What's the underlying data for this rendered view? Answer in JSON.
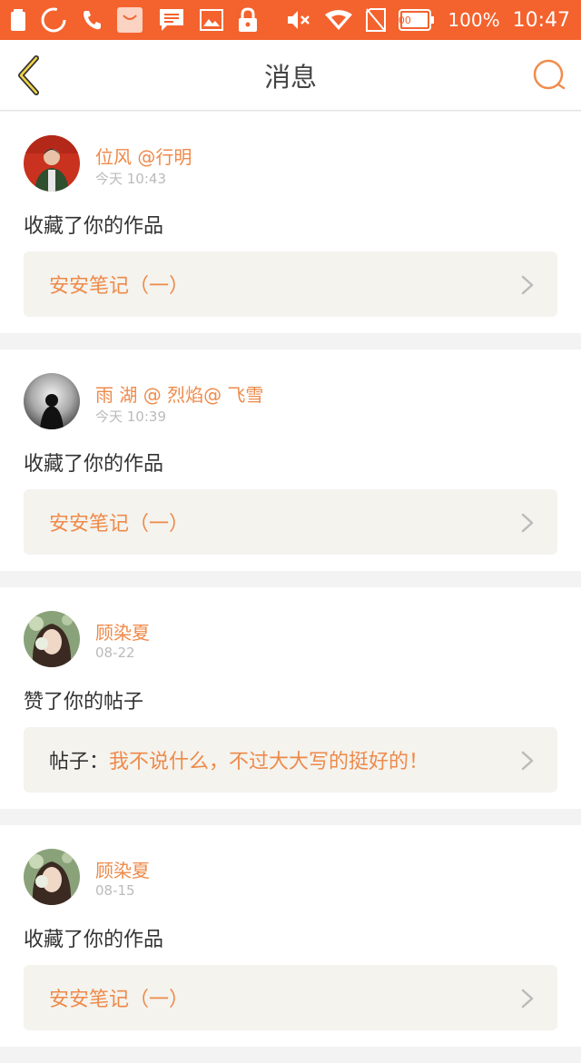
{
  "status_bar": {
    "battery_level": "100",
    "battery_percent": "100%",
    "time": "10:47",
    "color": "#f4622e"
  },
  "nav": {
    "title": "消息"
  },
  "messages": [
    {
      "user": "位风 @行明",
      "time": "今天 10:43",
      "action": "收藏了你的作品",
      "target_label": "",
      "target_text": "安安笔记（一）"
    },
    {
      "user": "雨 湖 @ 烈焰@ 飞雪",
      "time": "今天 10:39",
      "action": "收藏了你的作品",
      "target_label": "",
      "target_text": "安安笔记（一）"
    },
    {
      "user": "顾染夏",
      "time": "08-22",
      "action": "赞了你的帖子",
      "target_label": "帖子：",
      "target_text": "我不说什么，不过大大写的挺好的！"
    },
    {
      "user": "顾染夏",
      "time": "08-15",
      "action": "收藏了你的作品",
      "target_label": "",
      "target_text": "安安笔记（一）"
    }
  ],
  "accent_color": "#ee8a4a"
}
